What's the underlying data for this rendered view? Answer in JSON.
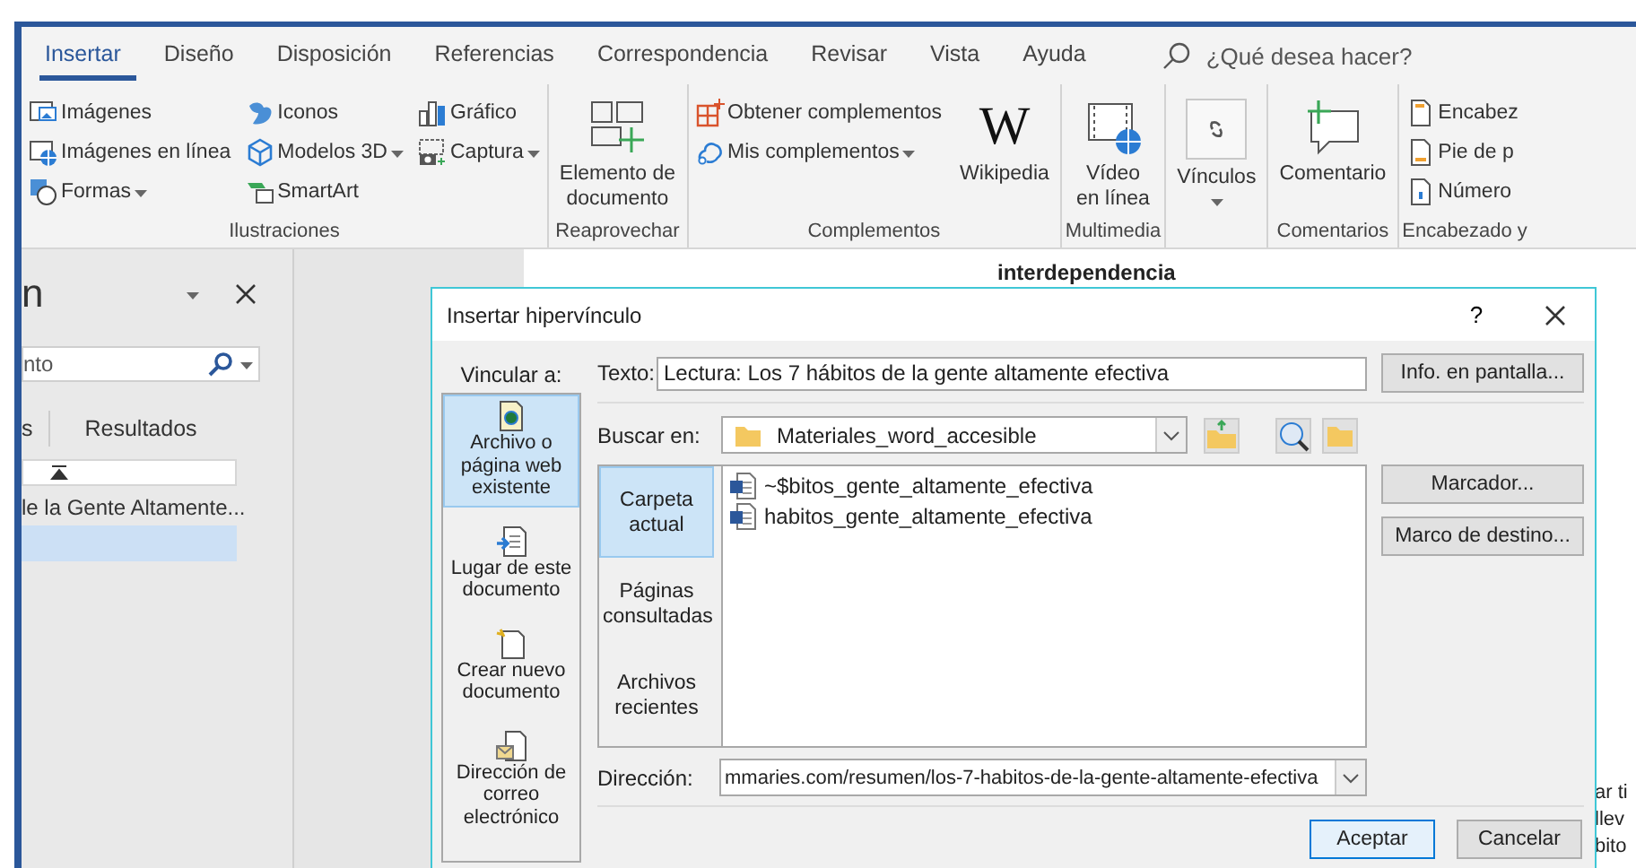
{
  "ribbon": {
    "tabs": [
      {
        "label": "Insertar",
        "selected": true
      },
      {
        "label": "Diseño",
        "selected": false
      },
      {
        "label": "Disposición",
        "selected": false
      },
      {
        "label": "Referencias",
        "selected": false
      },
      {
        "label": "Correspondencia",
        "selected": false
      },
      {
        "label": "Revisar",
        "selected": false
      },
      {
        "label": "Vista",
        "selected": false
      },
      {
        "label": "Ayuda",
        "selected": false
      }
    ],
    "tell_me": {
      "placeholder": "¿Qué desea hacer?"
    },
    "groups": [
      {
        "label": "Ilustraciones",
        "items": [
          {
            "kind": "small",
            "label": "Imágenes",
            "dropdown": false
          },
          {
            "kind": "small",
            "label": "Imágenes en línea",
            "dropdown": false
          },
          {
            "kind": "small",
            "label": "Formas",
            "dropdown": true
          },
          {
            "kind": "small",
            "label": "Iconos",
            "dropdown": false
          },
          {
            "kind": "small",
            "label": "Modelos 3D",
            "dropdown": true
          },
          {
            "kind": "small",
            "label": "SmartArt",
            "dropdown": false
          },
          {
            "kind": "small",
            "label": "Gráfico",
            "dropdown": false
          },
          {
            "kind": "small",
            "label": "Captura",
            "dropdown": true
          }
        ]
      },
      {
        "label": "Reaprovechar",
        "items": [
          {
            "kind": "large",
            "label": "Elemento de\ndocumento",
            "dropdown": false
          }
        ]
      },
      {
        "label": "Complementos",
        "items": [
          {
            "kind": "small",
            "label": "Obtener complementos",
            "dropdown": false
          },
          {
            "kind": "small",
            "label": "Mis complementos",
            "dropdown": true
          },
          {
            "kind": "logo",
            "logo_text": "W",
            "label": "Wikipedia",
            "dropdown": false
          }
        ]
      },
      {
        "label": "Multimedia",
        "items": [
          {
            "kind": "large",
            "label": "Vídeo\nen línea",
            "dropdown": false
          }
        ]
      },
      {
        "items": [
          {
            "kind": "large",
            "label": "Vínculos",
            "dropdown": true
          }
        ]
      },
      {
        "label": "Comentarios",
        "items": [
          {
            "kind": "large",
            "label": "Comentario",
            "dropdown": false
          }
        ]
      },
      {
        "label": "Encabezado y",
        "items": [
          {
            "kind": "small",
            "label": "Encabez",
            "dropdown": false
          },
          {
            "kind": "small",
            "label": "Pie de p",
            "dropdown": false
          },
          {
            "kind": "small",
            "label": "Número",
            "dropdown": false
          }
        ]
      }
    ]
  },
  "nav_pane": {
    "title": "n",
    "search": {
      "placeholder": "nto"
    },
    "tabs": [
      {
        "label": "s",
        "selected": false
      },
      {
        "label": "Resultados",
        "selected": false
      }
    ],
    "headings": [
      {
        "label": "le la Gente Altamente...",
        "selected": false
      }
    ],
    "selection_bar": true
  },
  "document": {
    "heading": "interdependencia",
    "side_lines": [
      "ar ti",
      "llev",
      "bito"
    ]
  },
  "dialog": {
    "title": "Insertar hipervínculo",
    "help": "?",
    "link_to": {
      "label": "Vincular a:",
      "items": [
        {
          "label": "Archivo o página web existente",
          "selected": true
        },
        {
          "label": "Lugar de este documento",
          "selected": false
        },
        {
          "label": "Crear nuevo documento",
          "selected": false
        },
        {
          "label": "Dirección de correo electrónico",
          "selected": false
        }
      ]
    },
    "text_field": {
      "label": "Texto:",
      "value": "Lectura: Los 7 hábitos de la gente altamente efectiva"
    },
    "screen_tip_button": "Info. en pantalla...",
    "look_in": {
      "label": "Buscar en:",
      "value": "Materiales_word_accesible"
    },
    "sources": [
      {
        "label": "Carpeta actual",
        "selected": true
      },
      {
        "label": "Páginas consultadas",
        "selected": false
      },
      {
        "label": "Archivos recientes",
        "selected": false
      }
    ],
    "files": [
      {
        "name": "~$bitos_gente_altamente_efectiva"
      },
      {
        "name": "habitos_gente_altamente_efectiva"
      }
    ],
    "side_buttons": [
      "Marcador...",
      "Marco de destino..."
    ],
    "address": {
      "label": "Dirección:",
      "value": "mmaries.com/resumen/los-7-habitos-de-la-gente-altamente-efectiva"
    },
    "ok_button": "Aceptar",
    "cancel_button": "Cancelar"
  }
}
